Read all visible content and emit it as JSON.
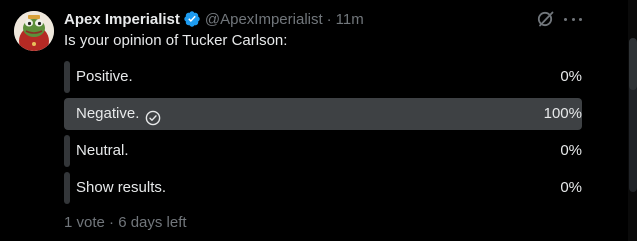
{
  "tweet": {
    "author_name": "Apex Imperialist",
    "handle": "@ApexImperialist",
    "separator": "·",
    "time": "11m",
    "question": "Is your opinion of Tucker Carlson:",
    "verified_color": "#1d9bf0"
  },
  "poll": {
    "options": [
      {
        "label": "Positive.",
        "percent": "0%",
        "fraction": 0.0,
        "selected": false
      },
      {
        "label": "Negative.",
        "percent": "100%",
        "fraction": 1.0,
        "selected": true
      },
      {
        "label": "Neutral.",
        "percent": "0%",
        "fraction": 0.0,
        "selected": false
      },
      {
        "label": "Show results.",
        "percent": "0%",
        "fraction": 0.0,
        "selected": false
      }
    ],
    "meta": "1 vote · 6 days left"
  },
  "icons": {
    "verified": "verified-badge-icon",
    "grok": "grok-icon",
    "more": "more-options-icon",
    "check": "check-circle-icon"
  }
}
